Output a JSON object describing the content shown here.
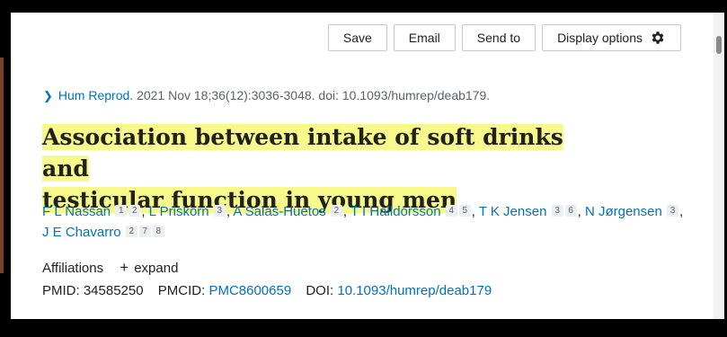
{
  "toolbar": {
    "save": "Save",
    "email": "Email",
    "send_to": "Send to",
    "display_options": "Display options"
  },
  "citation": {
    "journal": "Hum Reprod.",
    "details": "2021 Nov 18;36(12):3036-3048. doi: 10.1093/humrep/deab179."
  },
  "title": {
    "line1": "Association between intake of soft drinks and",
    "line2": "testicular function in young men"
  },
  "authors": [
    {
      "name": "F L Nassan",
      "affils": [
        "1",
        "2"
      ]
    },
    {
      "name": "L Priskorn",
      "affils": [
        "3"
      ]
    },
    {
      "name": "A Salas-Huetos",
      "affils": [
        "2"
      ]
    },
    {
      "name": "T I Halldorsson",
      "affils": [
        "4",
        "5"
      ]
    },
    {
      "name": "T K Jensen",
      "affils": [
        "3",
        "6"
      ]
    },
    {
      "name": "N Jørgensen",
      "affils": [
        "3"
      ]
    },
    {
      "name": "J E Chavarro",
      "affils": [
        "2",
        "7",
        "8"
      ]
    }
  ],
  "affiliations": {
    "label": "Affiliations",
    "expand": "expand"
  },
  "ids": {
    "pmid_label": "PMID:",
    "pmid": "34585250",
    "pmcid_label": "PMCID:",
    "pmcid": "PMC8600659",
    "doi_label": "DOI:",
    "doi": "10.1093/humrep/deab179"
  }
}
